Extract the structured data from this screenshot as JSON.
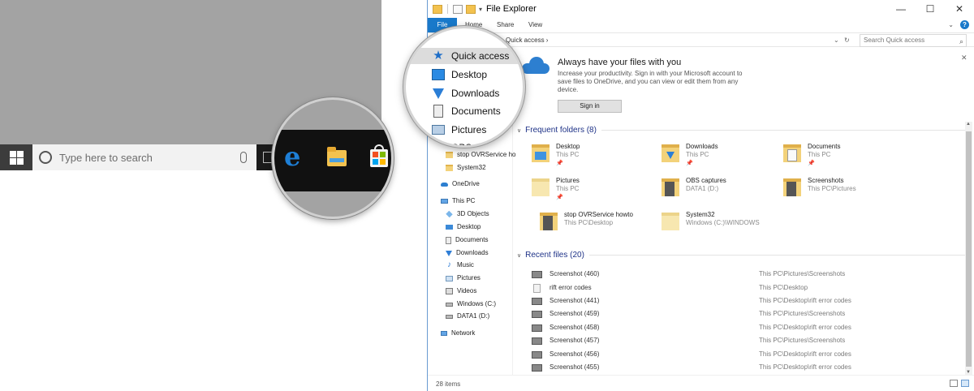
{
  "desktop": {
    "search_placeholder": "Type here to search"
  },
  "explorer": {
    "title": "File Explorer",
    "window_controls": {
      "minimize": "—",
      "maximize": "☐",
      "close": "✕"
    },
    "ribbon_tabs": [
      "File",
      "Home",
      "Share",
      "View"
    ],
    "help": "?",
    "address": "Quick access  ›",
    "address_dropdown": "⌄",
    "refresh": "↻",
    "search_placeholder": "Search Quick access",
    "nav_items": [
      {
        "label": "stop OVRService ho",
        "icon": "folder-icon"
      },
      {
        "label": "System32",
        "icon": "folder-icon"
      },
      {
        "label": "OneDrive",
        "icon": "cloud-icon"
      },
      {
        "label": "This PC",
        "icon": "pc-icon"
      },
      {
        "label": "3D Objects",
        "icon": "cube-icon"
      },
      {
        "label": "Desktop",
        "icon": "desktop-icon"
      },
      {
        "label": "Documents",
        "icon": "document-icon"
      },
      {
        "label": "Downloads",
        "icon": "download-icon"
      },
      {
        "label": "Music",
        "icon": "music-icon"
      },
      {
        "label": "Pictures",
        "icon": "pictures-icon"
      },
      {
        "label": "Videos",
        "icon": "videos-icon"
      },
      {
        "label": "Windows (C:)",
        "icon": "drive-icon"
      },
      {
        "label": "DATA1 (D:)",
        "icon": "drive-icon"
      },
      {
        "label": "Network",
        "icon": "network-icon"
      }
    ],
    "zoom_nav": [
      {
        "label": "Quick access",
        "icon": "star-icon"
      },
      {
        "label": "Desktop",
        "icon": "desktop-icon"
      },
      {
        "label": "Downloads",
        "icon": "download-icon"
      },
      {
        "label": "Documents",
        "icon": "document-icon"
      },
      {
        "label": "Pictures",
        "icon": "pictures-icon"
      },
      {
        "label": "OBS ca",
        "icon": "folder-icon"
      }
    ],
    "banner": {
      "title": "Always have your files with you",
      "body": "Increase your productivity. Sign in with your Microsoft account to save files to OneDrive, and you can view or edit them from any device.",
      "button": "Sign in",
      "close": "✕"
    },
    "frequent_header": "Frequent folders (8)",
    "frequent_folders": [
      {
        "name": "Desktop",
        "location": "This PC"
      },
      {
        "name": "Downloads",
        "location": "This PC"
      },
      {
        "name": "Documents",
        "location": "This PC"
      },
      {
        "name": "Pictures",
        "location": "This PC"
      },
      {
        "name": "OBS captures",
        "location": "DATA1 (D:)"
      },
      {
        "name": "Screenshots",
        "location": "This PC\\Pictures"
      },
      {
        "name": "stop OVRService howto",
        "location": "This PC\\Desktop"
      },
      {
        "name": "System32",
        "location": "Windows (C:)\\WINDOWS"
      }
    ],
    "recent_header": "Recent files (20)",
    "recent_files": [
      {
        "name": "Screenshot (460)",
        "location": "This PC\\Pictures\\Screenshots"
      },
      {
        "name": "rift error codes",
        "location": "This PC\\Desktop"
      },
      {
        "name": "Screenshot (441)",
        "location": "This PC\\Desktop\\rift error codes"
      },
      {
        "name": "Screenshot (459)",
        "location": "This PC\\Pictures\\Screenshots"
      },
      {
        "name": "Screenshot (458)",
        "location": "This PC\\Desktop\\rift error codes"
      },
      {
        "name": "Screenshot (457)",
        "location": "This PC\\Pictures\\Screenshots"
      },
      {
        "name": "Screenshot (456)",
        "location": "This PC\\Desktop\\rift error codes"
      },
      {
        "name": "Screenshot (455)",
        "location": "This PC\\Desktop\\rift error codes"
      }
    ],
    "status": "28 items"
  }
}
